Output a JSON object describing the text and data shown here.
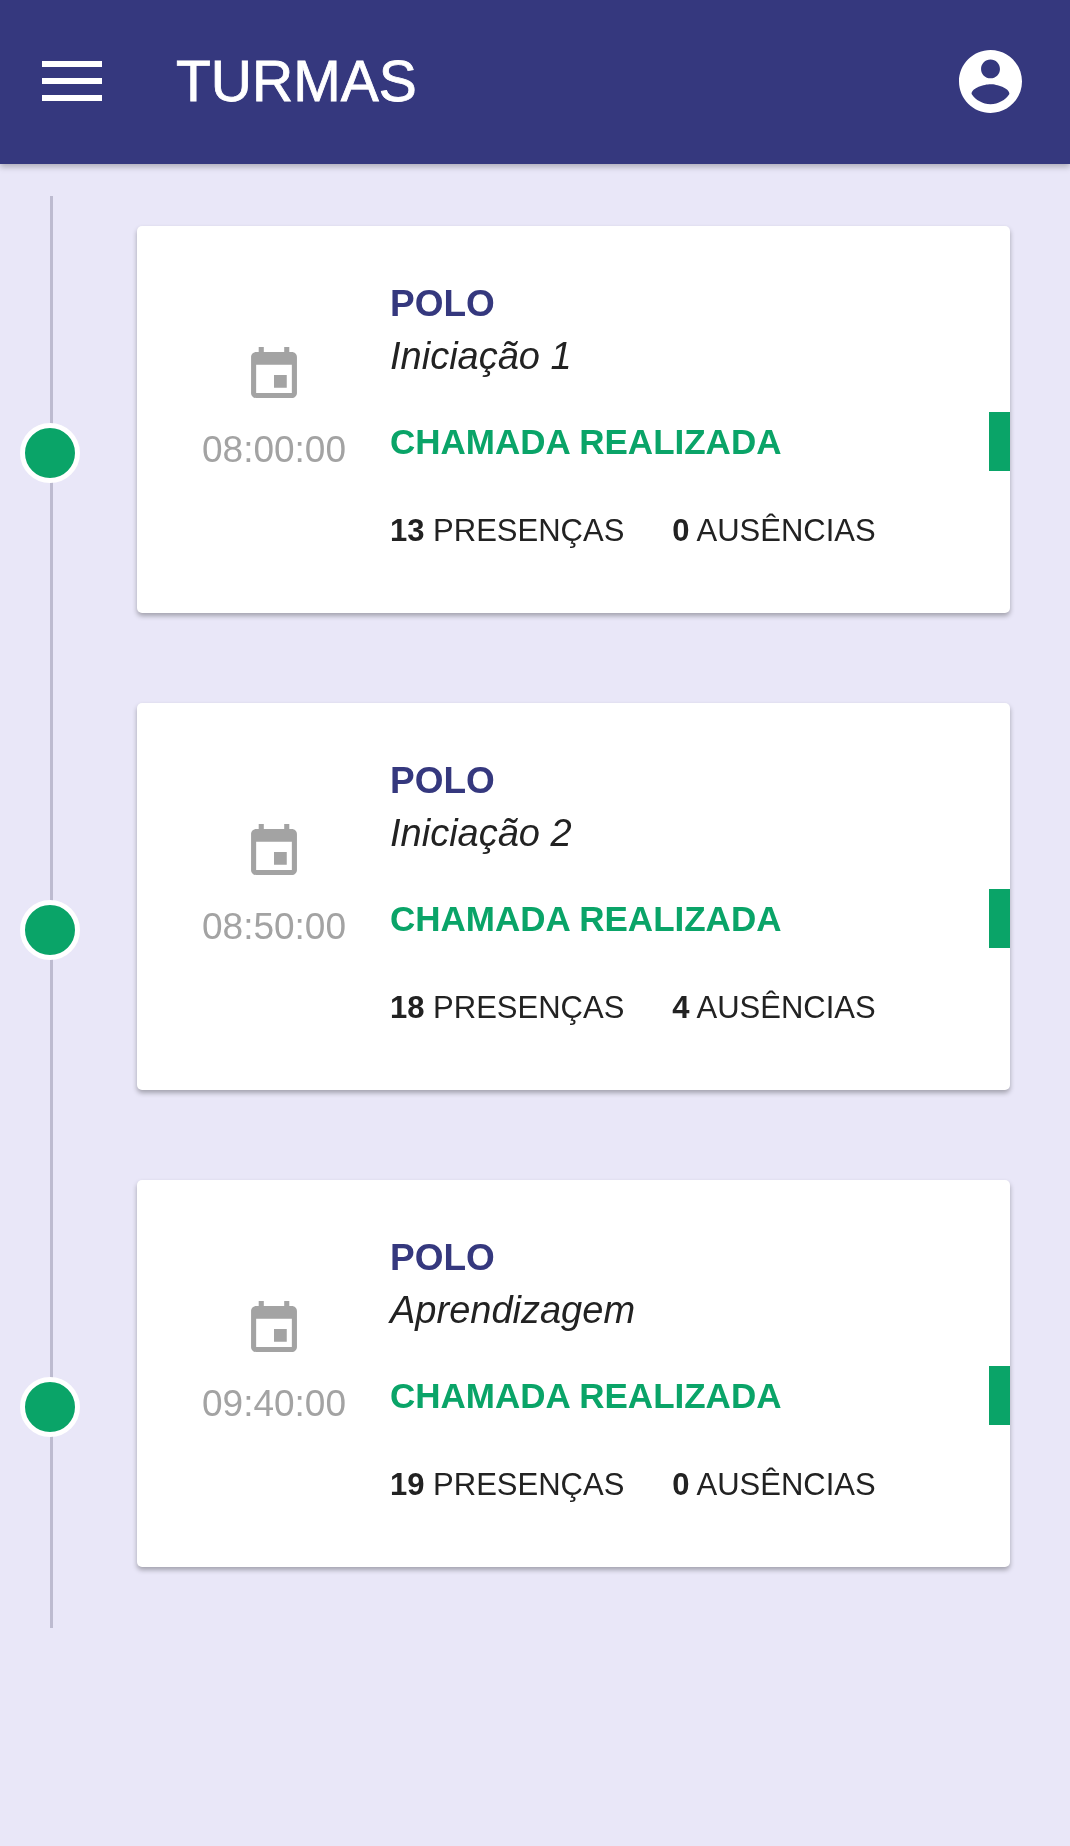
{
  "app_bar": {
    "title": "TURMAS"
  },
  "classes": [
    {
      "time": "08:00:00",
      "category": "POLO",
      "name": "Iniciação 1",
      "status": "CHAMADA REALIZADA",
      "color": "#0aa468",
      "presences": "**13** PRESENÇAS",
      "absences": "**0** AUSÊNCIAS"
    },
    {
      "time": "08:50:00",
      "category": "POLO",
      "name": "Iniciação 2",
      "status": "CHAMADA REALIZADA",
      "color": "#0aa468",
      "presences": "**18** PRESENÇAS",
      "absences": "**4** AUSÊNCIAS"
    },
    {
      "time": "09:40:00",
      "category": "POLO",
      "name": "Aprendizagem",
      "status": "CHAMADA REALIZADA",
      "color": "#0aa468",
      "presences": "**19** PRESENÇAS",
      "absences": "**0** AUSÊNCIAS"
    }
  ]
}
